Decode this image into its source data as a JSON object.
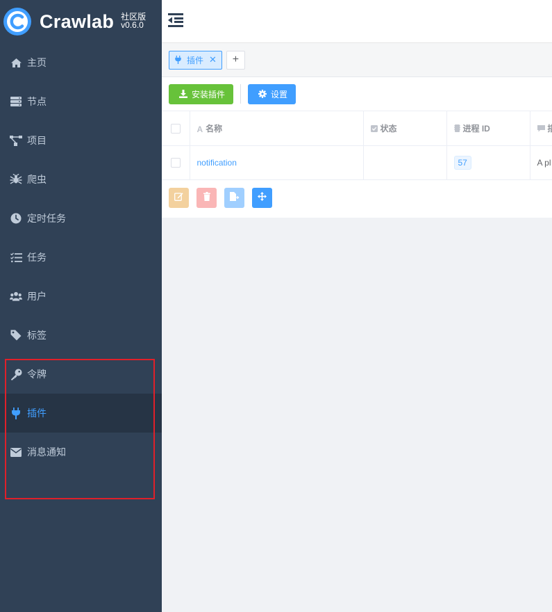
{
  "app": {
    "name": "Crawlab",
    "edition": "社区版",
    "version": "v0.6.0"
  },
  "sidebar": {
    "items": [
      {
        "label": "主页",
        "icon": "home-icon"
      },
      {
        "label": "节点",
        "icon": "server-icon"
      },
      {
        "label": "项目",
        "icon": "project-tree-icon"
      },
      {
        "label": "爬虫",
        "icon": "spider-icon"
      },
      {
        "label": "定时任务",
        "icon": "clock-icon"
      },
      {
        "label": "任务",
        "icon": "task-list-icon"
      },
      {
        "label": "用户",
        "icon": "users-icon"
      },
      {
        "label": "标签",
        "icon": "tag-icon"
      },
      {
        "label": "令牌",
        "icon": "key-icon"
      },
      {
        "label": "插件",
        "icon": "plug-icon",
        "active": true
      },
      {
        "label": "消息通知",
        "icon": "envelope-icon"
      }
    ]
  },
  "tabs": [
    {
      "label": "插件",
      "icon": "plug-icon"
    }
  ],
  "toolbar": {
    "install_label": "安装插件",
    "settings_label": "设置"
  },
  "table": {
    "columns": [
      {
        "label": "名称",
        "icon": "text-icon"
      },
      {
        "label": "状态",
        "icon": "check-square-icon"
      },
      {
        "label": "进程 ID",
        "icon": "memory-icon"
      },
      {
        "label": "描述",
        "icon": "comment-icon"
      }
    ],
    "rows": [
      {
        "name": "notification",
        "status": "",
        "pid": "57",
        "description": "A pl"
      }
    ]
  },
  "colors": {
    "sidebar_bg": "#304156",
    "primary": "#409eff",
    "success": "#67c23a",
    "highlight_border": "#e0202a"
  }
}
